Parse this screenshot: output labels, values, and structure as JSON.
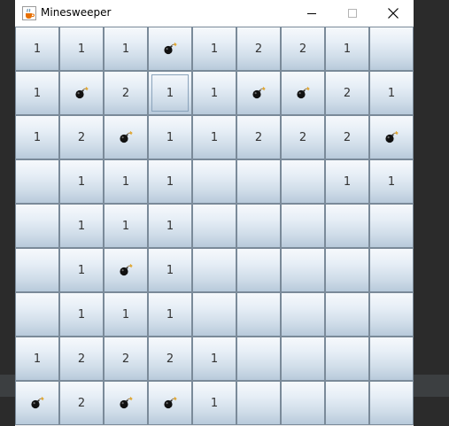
{
  "window": {
    "title": "Minesweeper",
    "controls": [
      "minimize",
      "maximize",
      "close"
    ]
  },
  "board": {
    "rows": 9,
    "cols": 9,
    "focused_cell": [
      1,
      3
    ],
    "cells": [
      [
        "1",
        "1",
        "1",
        "mine",
        "1",
        "2",
        "2",
        "1",
        ""
      ],
      [
        "1",
        "mine",
        "2",
        "1",
        "1",
        "mine",
        "mine",
        "2",
        "1"
      ],
      [
        "1",
        "2",
        "mine",
        "1",
        "1",
        "2",
        "2",
        "2",
        "mine"
      ],
      [
        "",
        "1",
        "1",
        "1",
        "",
        "",
        "",
        "1",
        "1"
      ],
      [
        "",
        "1",
        "1",
        "1",
        "",
        "",
        "",
        "",
        ""
      ],
      [
        "",
        "1",
        "mine",
        "1",
        "",
        "",
        "",
        "",
        ""
      ],
      [
        "",
        "1",
        "1",
        "1",
        "",
        "",
        "",
        "",
        ""
      ],
      [
        "1",
        "2",
        "2",
        "2",
        "1",
        "",
        "",
        "",
        ""
      ],
      [
        "mine",
        "2",
        "mine",
        "mine",
        "1",
        "",
        "",
        "",
        ""
      ]
    ]
  },
  "icons": {
    "app": "java-coffee-cup-icon",
    "mine": "bomb-icon"
  },
  "colors": {
    "cell_top": "#f6f9fc",
    "cell_bottom": "#b8cadb",
    "cell_border": "#7a8a99",
    "number_text": "#333333",
    "titlebar": "#ffffff"
  }
}
